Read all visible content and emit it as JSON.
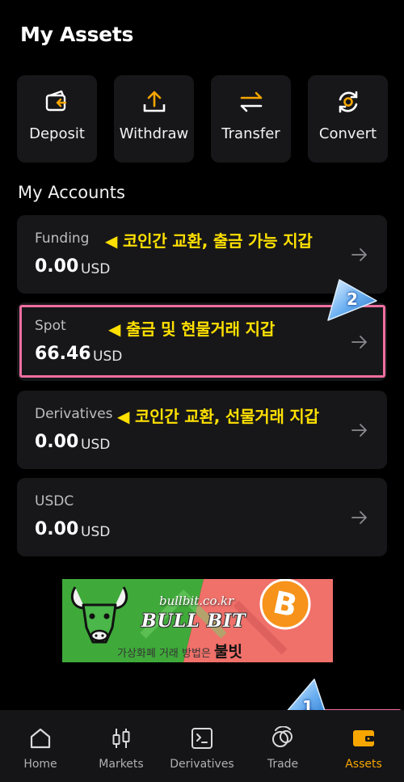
{
  "page": {
    "title": "My Assets"
  },
  "actions": [
    {
      "label": "Deposit",
      "icon": "deposit-icon"
    },
    {
      "label": "Withdraw",
      "icon": "withdraw-icon"
    },
    {
      "label": "Transfer",
      "icon": "transfer-icon"
    },
    {
      "label": "Convert",
      "icon": "convert-icon"
    }
  ],
  "accounts": {
    "section_title": "My Accounts",
    "items": [
      {
        "name": "Funding",
        "amount": "0.00",
        "unit": "USD",
        "note": "◀ 코인간 교환, 출금 가능 지갑"
      },
      {
        "name": "Spot",
        "amount": "66.46",
        "unit": "USD",
        "note": "◀ 출금 및 현물거래 지갑"
      },
      {
        "name": "Derivatives",
        "amount": "0.00",
        "unit": "USD",
        "note": "◀ 코인간 교환, 선물거래 지갑"
      },
      {
        "name": "USDC",
        "amount": "0.00",
        "unit": "USD"
      }
    ]
  },
  "annotations": {
    "badge_1": "1",
    "badge_2": "2"
  },
  "banner": {
    "url": "bullbit.co.kr",
    "name": "BULL BIT",
    "tagline": "가상화폐 거래 방법은",
    "tagline_brand": "불빗"
  },
  "tabs": [
    {
      "label": "Home",
      "icon": "home-icon",
      "active": false
    },
    {
      "label": "Markets",
      "icon": "candlestick-icon",
      "active": false
    },
    {
      "label": "Derivatives",
      "icon": "terminal-icon",
      "active": false
    },
    {
      "label": "Trade",
      "icon": "trade-icon",
      "active": false
    },
    {
      "label": "Assets",
      "icon": "wallet-icon",
      "active": true
    }
  ],
  "colors": {
    "accent": "#f7a600",
    "highlight": "#f06ea0",
    "note_text": "#ffe000",
    "card_bg": "#17171a"
  }
}
